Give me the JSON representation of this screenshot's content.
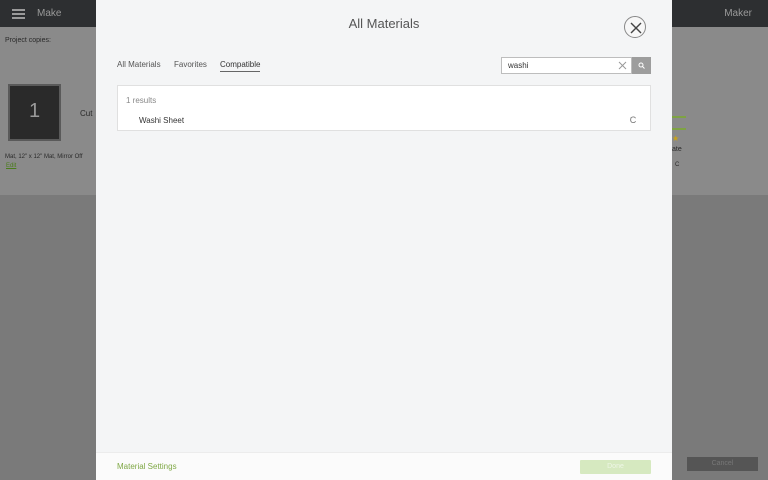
{
  "app": {
    "title": "Make",
    "title_right": "Maker",
    "project_copies_label": "Project copies:",
    "mat_number": "1",
    "cut_label": "Cut",
    "mat_info": "Mat, 12\" x 12\" Mat, Mirror Off",
    "edit_label": "Edit",
    "side_text": "ate",
    "side_c": "C",
    "cancel_label": "Cancel"
  },
  "modal": {
    "title": "All Materials",
    "tabs": [
      {
        "label": "All Materials",
        "active": false
      },
      {
        "label": "Favorites",
        "active": false
      },
      {
        "label": "Compatible",
        "active": true
      }
    ],
    "search": {
      "value": "washi",
      "placeholder": ""
    },
    "results_count": "1 results",
    "results": [
      {
        "name": "Washi Sheet",
        "icon": "c-compatible-icon",
        "icon_glyph": "C"
      }
    ],
    "footer": {
      "material_settings_label": "Material Settings",
      "done_label": "Done"
    }
  },
  "colors": {
    "accent_green": "#7fa845",
    "done_disabled": "#d6e9c0",
    "modal_bg": "#f4f5f6",
    "topbar": "#2d2f31"
  }
}
